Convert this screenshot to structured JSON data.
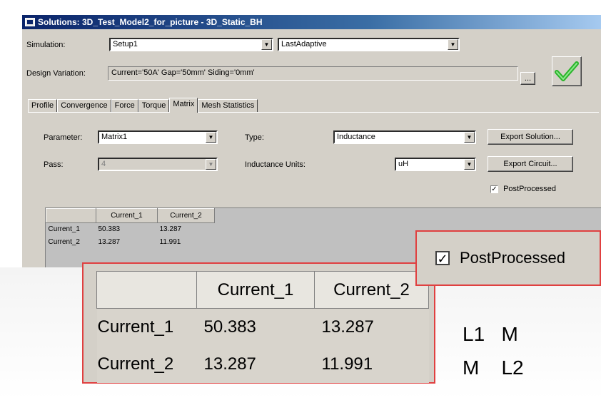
{
  "window": {
    "title": "Solutions: 3D_Test_Model2_for_picture - 3D_Static_BH"
  },
  "simulation": {
    "label": "Simulation:",
    "setup_value": "Setup1",
    "pass_value": "LastAdaptive"
  },
  "design_variation": {
    "label": "Design Variation:",
    "value": "Current='50A' Gap='50mm' Siding='0mm'",
    "browse_label": "..."
  },
  "tabs": [
    "Profile",
    "Convergence",
    "Force",
    "Torque",
    "Matrix",
    "Mesh Statistics"
  ],
  "active_tab": "Matrix",
  "matrix_panel": {
    "parameter_label": "Parameter:",
    "parameter_value": "Matrix1",
    "type_label": "Type:",
    "type_value": "Inductance",
    "pass_label": "Pass:",
    "pass_value": "4",
    "units_label": "Inductance Units:",
    "units_value": "uH",
    "export_solution_label": "Export Solution...",
    "export_circuit_label": "Export Circuit...",
    "postprocessed_label": "PostProcessed",
    "postprocessed_checked": true
  },
  "matrix": {
    "columns": [
      "Current_1",
      "Current_2"
    ],
    "rows": [
      {
        "name": "Current_1",
        "values": [
          "50.383",
          "13.287"
        ]
      },
      {
        "name": "Current_2",
        "values": [
          "13.287",
          "11.991"
        ]
      }
    ]
  },
  "annotation": {
    "line1": "L1   M",
    "line2": "M    L2"
  },
  "colors": {
    "title_bar": "#0a246a",
    "highlight_border": "#e04040",
    "checkmark": "#2bb52b"
  }
}
